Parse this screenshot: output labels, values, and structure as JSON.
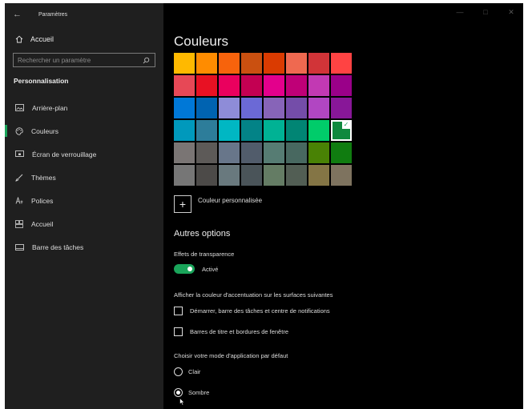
{
  "window": {
    "title": "Paramètres"
  },
  "sidebar": {
    "home_label": "Accueil",
    "search_placeholder": "Rechercher un paramètre",
    "section_title": "Personnalisation",
    "items": [
      {
        "label": "Arrière-plan",
        "icon": "picture-icon",
        "active": false
      },
      {
        "label": "Couleurs",
        "icon": "palette-icon",
        "active": true
      },
      {
        "label": "Écran de verrouillage",
        "icon": "lock-screen-icon",
        "active": false
      },
      {
        "label": "Thèmes",
        "icon": "brush-icon",
        "active": false
      },
      {
        "label": "Polices",
        "icon": "font-icon",
        "active": false
      },
      {
        "label": "Accueil",
        "icon": "start-icon",
        "active": false
      },
      {
        "label": "Barre des tâches",
        "icon": "taskbar-icon",
        "active": false
      }
    ]
  },
  "main": {
    "title": "Couleurs",
    "swatches": [
      "#FFB900",
      "#FF8C00",
      "#F7630C",
      "#CA5010",
      "#DA3B01",
      "#EF6950",
      "#D13438",
      "#FF4343",
      "#E74856",
      "#E81123",
      "#EA005E",
      "#C30052",
      "#E3008C",
      "#BF0077",
      "#C239B3",
      "#9A0089",
      "#0078D7",
      "#0063B1",
      "#8E8CD8",
      "#6B69D6",
      "#8764B8",
      "#744DA9",
      "#B146C2",
      "#881798",
      "#0099BC",
      "#2D7D9A",
      "#00B7C3",
      "#038387",
      "#00B294",
      "#018574",
      "#00CC6A",
      "#10893E",
      "#7A7574",
      "#5D5A58",
      "#68768A",
      "#515C6B",
      "#567C73",
      "#486860",
      "#498205",
      "#107C10",
      "#767676",
      "#4C4A48",
      "#69797E",
      "#4A5459",
      "#647C64",
      "#525E54",
      "#847545",
      "#7E735F"
    ],
    "selected_swatch_index": 31,
    "accent_color": "#1AA45A",
    "custom_color_label": "Couleur personnalisée",
    "other_options_title": "Autres options",
    "transparency_label": "Effets de transparence",
    "transparency_state": "Activé",
    "transparency_on": true,
    "accent_surfaces_label": "Afficher la couleur d'accentuation sur les surfaces suivantes",
    "checkbox_start_label": "Démarrer, barre des tâches et centre de notifications",
    "checkbox_titlebars_label": "Barres de titre et bordures de fenêtre",
    "app_mode_label": "Choisir votre mode d'application par défaut",
    "radio_light_label": "Clair",
    "radio_dark_label": "Sombre",
    "selected_mode": "Sombre"
  }
}
